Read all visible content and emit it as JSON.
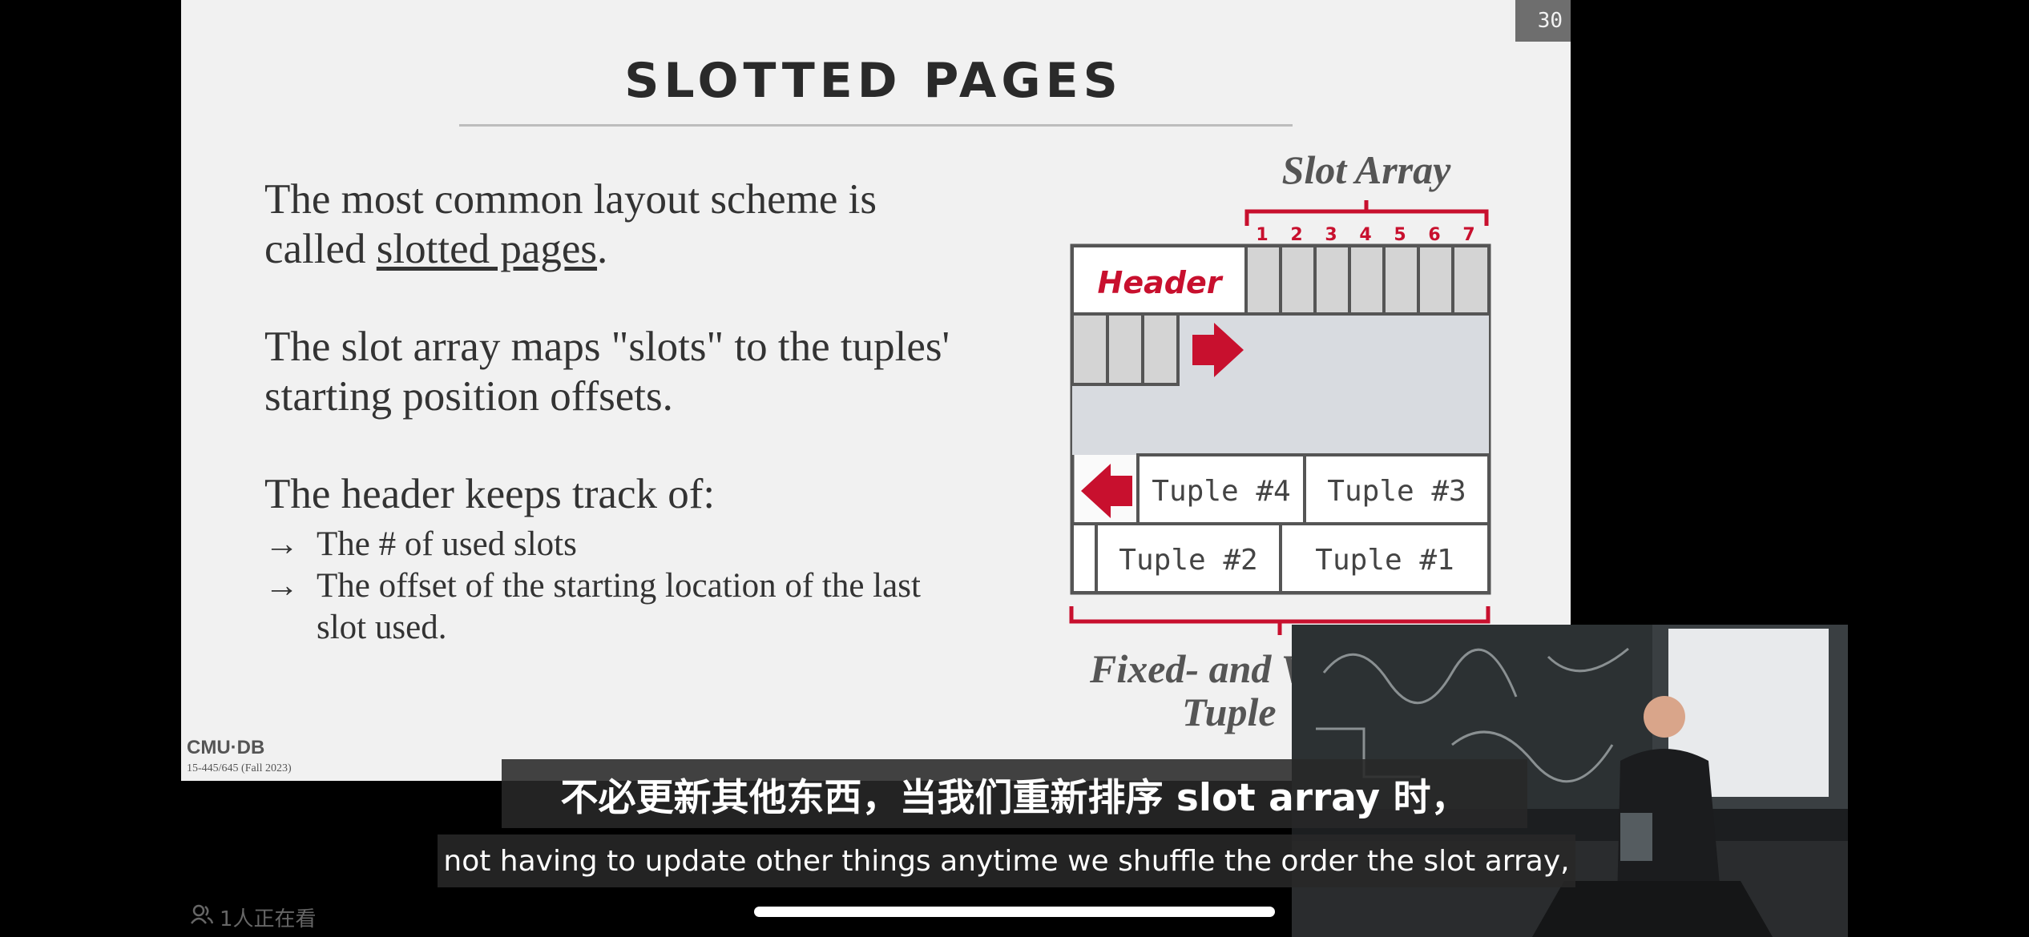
{
  "slide": {
    "page_number": "30",
    "title": "SLOTTED PAGES",
    "para1_pre": "The most common layout scheme is called ",
    "para1_link": "slotted pages",
    "para1_post": ".",
    "para2": "The slot array maps \"slots\" to the tuples' starting position offsets.",
    "para3": "The header keeps track of:",
    "bullets": [
      "The # of used slots",
      "The offset of the starting location of the last slot used."
    ],
    "bullet_arrow": "→",
    "logo": "CMU·DB",
    "course": "15-445/645 (Fall 2023)"
  },
  "diagram": {
    "slot_array_label": "Slot Array",
    "slot_numbers": [
      "1",
      "2",
      "3",
      "4",
      "5",
      "6",
      "7"
    ],
    "header_label": "Header",
    "tuples": [
      "Tuple #4",
      "Tuple #3",
      "Tuple #2",
      "Tuple #1"
    ],
    "bottom_label_line1": "Fixed- and V",
    "bottom_label_line2": "Tuple",
    "colors": {
      "accent": "#c8102e",
      "free_space": "#d8dbe0",
      "slot": "#d4d4d4",
      "border": "#555555"
    }
  },
  "subtitles": {
    "chinese": "不必更新其他东西，当我们重新排序 slot array 时，",
    "english": "not having to update other things anytime we shuffle the order the slot array,"
  },
  "viewers": {
    "text": "1人正在看",
    "icon": "viewer-icon"
  },
  "video": {
    "icon": "lecturer-video"
  }
}
